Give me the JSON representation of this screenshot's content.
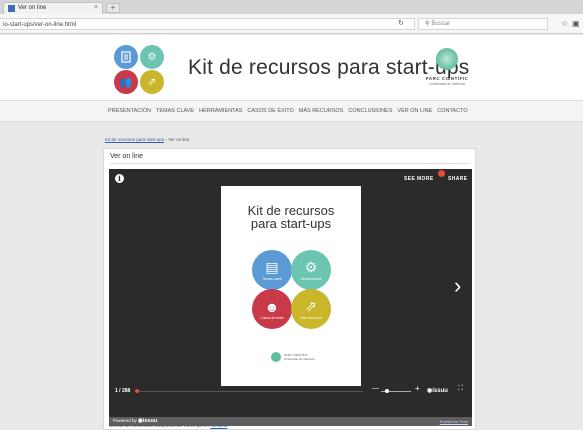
{
  "browser": {
    "tab_title": "Ver on line",
    "tab_close": "×",
    "new_tab": "+",
    "url": "io-start-ups/ver-on-line.html",
    "search_placeholder": "Buscar",
    "reload_icon": "reload-icon",
    "star_icon": "star-icon"
  },
  "header": {
    "title": "Kit de recursos para start-ups",
    "logo_labels": [
      "Temas clave",
      "Herramientas",
      "Casos de éxito",
      "Más recursos"
    ],
    "parc_name": "PARC CIENTÍFIC",
    "parc_sub": "Universitat de València"
  },
  "nav": {
    "items": [
      "PRESENTACIÓN",
      "TEMAS CLAVE",
      "HERRAMIENTAS",
      "CASOS DE ÉXITO",
      "MÁS RECURSOS",
      "CONCLUSIONES",
      "VER ON LINE",
      "CONTACTO"
    ]
  },
  "breadcrumb": {
    "link": "Kit de recursos para start-ups",
    "separator": "›",
    "current": "Ver on line"
  },
  "card": {
    "title": "Ver on line"
  },
  "viewer": {
    "see_more": "SEE MORE",
    "share": "SHARE",
    "doc_title_line1": "Kit de recursos",
    "doc_title_line2": "para start-ups",
    "circles": [
      {
        "label": "Temas clave",
        "color": "#5b9bd5"
      },
      {
        "label": "Herramientas",
        "color": "#6cc5b0"
      },
      {
        "label": "Casos de éxito",
        "color": "#c8394a"
      },
      {
        "label": "Más recursos",
        "color": "#c9b62a"
      }
    ],
    "page_count": "1 / 288",
    "current_page": 1,
    "total_pages": 288,
    "zoom_minus": "—",
    "zoom_plus": "+",
    "issuu_label": "issuu",
    "powered_by": "Powered by",
    "issuu_brand": "issuu",
    "publish_link": "Publish for Free"
  },
  "footnote": {
    "text": "Solicita los contenidos completos del Kit en pdf en ",
    "link": "contacto",
    "end": "."
  },
  "colors": {
    "accent_blue": "#5b9bd5",
    "accent_teal": "#6cc5b0",
    "accent_red": "#c8394a",
    "accent_yellow": "#c9b62a"
  }
}
